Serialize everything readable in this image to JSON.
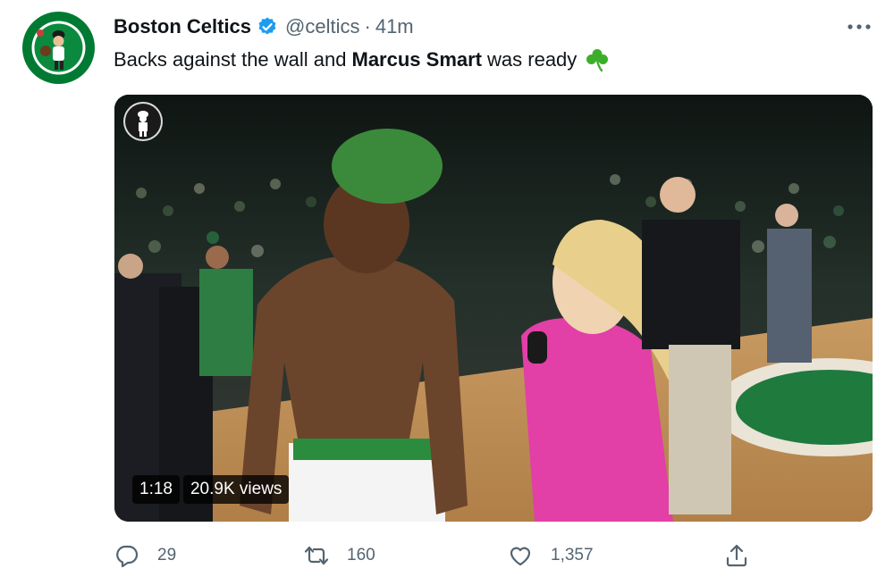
{
  "tweet": {
    "author_name": "Boston Celtics",
    "handle": "@celtics",
    "separator": "·",
    "time": "41m",
    "text_part1": "Backs against the wall and",
    "text_bold": "Marcus Smart",
    "text_part2": "was ready",
    "emoji": "shamrock-icon"
  },
  "video": {
    "duration": "1:18",
    "views": "20.9K views"
  },
  "actions": {
    "replies": "29",
    "retweets": "160",
    "likes": "1,357"
  },
  "colors": {
    "verified": "#1d9bf0",
    "celtics_green": "#007a33",
    "text_secondary": "#536471",
    "shamrock": "#3dae2b"
  }
}
